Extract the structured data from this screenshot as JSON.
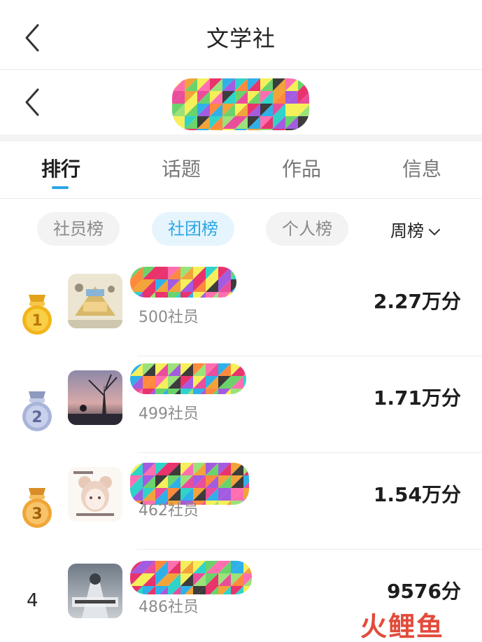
{
  "header": {
    "title": "文学社"
  },
  "tabs": [
    {
      "label": "排行",
      "active": true
    },
    {
      "label": "话题",
      "active": false
    },
    {
      "label": "作品",
      "active": false
    },
    {
      "label": "信息",
      "active": false
    }
  ],
  "filters": [
    {
      "label": "社员榜",
      "active": false
    },
    {
      "label": "社团榜",
      "active": true
    },
    {
      "label": "个人榜",
      "active": false
    }
  ],
  "period": {
    "label": "周榜"
  },
  "ranking": [
    {
      "rank": "1",
      "medal": "gold",
      "members": "500社员",
      "score": "2.27万分"
    },
    {
      "rank": "2",
      "medal": "silver",
      "members": "499社员",
      "score": "1.71万分"
    },
    {
      "rank": "3",
      "medal": "bronze",
      "members": "462社员",
      "score": "1.54万分"
    },
    {
      "rank": "4",
      "medal": "none",
      "members": "486社员",
      "score": "9576分"
    }
  ],
  "watermark": "火鲤鱼",
  "colors": {
    "accent": "#2da7e6",
    "gold": "#f2b51c",
    "silver": "#a8b4d8",
    "bronze": "#f0a637"
  },
  "icons": {
    "back": "chevron-left-icon",
    "dropdown": "chevron-down-icon"
  }
}
